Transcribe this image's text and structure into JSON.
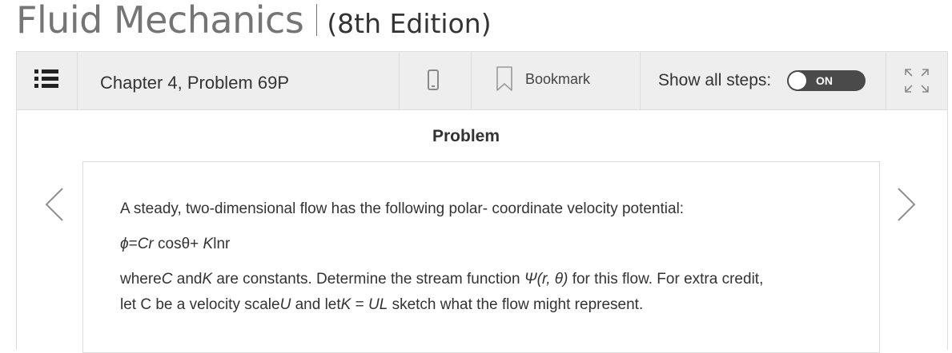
{
  "book": {
    "title": "Fluid Mechanics",
    "edition": "(8th Edition)"
  },
  "toolbar": {
    "menu_icon": "list-icon",
    "chapter_label": "Chapter 4, Problem 69P",
    "mobile_icon": "mobile-phone-icon",
    "bookmark_icon": "bookmark-icon",
    "bookmark_label": "Bookmark",
    "steps_label": "Show all steps:",
    "steps_toggle": "ON",
    "expand_icon": "expand-icon"
  },
  "content": {
    "heading": "Problem",
    "prev_icon": "chevron-left-icon",
    "next_icon": "chevron-right-icon",
    "problem": {
      "line1": "A steady, two-dimensional flow has the following polar- coordinate velocity potential:",
      "eq_phi": "ϕ",
      "eq_eq": "=",
      "eq_cr": "Cr",
      "eq_cos": " cosθ+ ",
      "eq_k": "K",
      "eq_ln": "lnr",
      "l3_where": "where",
      "l3_c": "C",
      "l3_and": " and",
      "l3_k": "K",
      "l3_rest": " are constants. Determine the stream function ",
      "l3_psi": "Ψ(r, θ)",
      "l3_end": " for this flow. For extra credit,",
      "l4_a": "let C be a velocity scale",
      "l4_u": "U",
      "l4_b": " and let",
      "l4_k": "K",
      "l4_eq": " = ",
      "l4_ul": "UL",
      "l4_c": " sketch what the flow might represent."
    }
  },
  "colors": {
    "toolbar_bg": "#eeeeee",
    "toggle_bg": "#4a4a4a",
    "title_gray": "#757575"
  }
}
